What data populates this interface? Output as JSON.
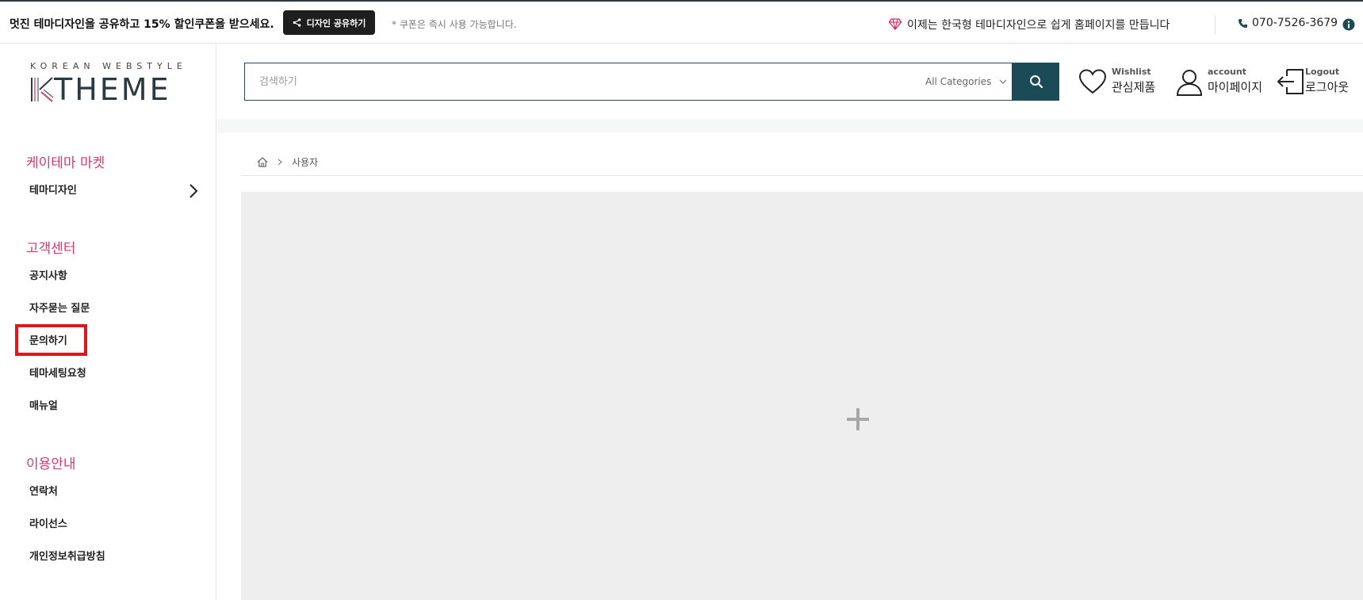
{
  "topbar": {
    "promo_text": "멋진 테마디자인을 공유하고 15% 할인쿠폰을 받으세요.",
    "share_button_label": "디자인 공유하기",
    "coupon_note": "* 쿠폰은 즉시 사용 가능합니다.",
    "slogan": "이제는 한국형 테마디자인으로 쉽게 홈페이지를 만듭니다",
    "phone": "070-7526-3679",
    "icons": {
      "share": "share-icon",
      "diamond": "diamond-icon",
      "phone": "phone-icon",
      "info": "info-icon"
    },
    "accent_color": "#d63a6e"
  },
  "logo": {
    "small_text": "KOREAN WEBSTYLE",
    "big_text": "THEME",
    "k_letter": "K"
  },
  "sidebar": {
    "sections": [
      {
        "title": "케이테마 마켓",
        "items": [
          "테마디자인"
        ]
      },
      {
        "title": "고객센터",
        "items": [
          "공지사항",
          "자주묻는 질문",
          "문의하기",
          "테마세팅요청",
          "매뉴얼"
        ]
      },
      {
        "title": "이용안내",
        "items": [
          "연락처",
          "라이선스",
          "개인정보취급방침"
        ]
      }
    ],
    "section_title_color": "#d63a6e",
    "highlighted_item": "문의하기"
  },
  "header": {
    "search_placeholder": "검색하기",
    "category_label": "All Categories",
    "search_button_color": "#1b4b57",
    "wishlist": {
      "small": "Wishlist",
      "big": "관심제품"
    },
    "account": {
      "small": "account",
      "big": "마이페이지"
    },
    "logout": {
      "small": "Logout",
      "big": "로그아웃"
    }
  },
  "breadcrumb": {
    "current": "사용자"
  },
  "content": {
    "placeholder_icon": "plus-icon"
  }
}
